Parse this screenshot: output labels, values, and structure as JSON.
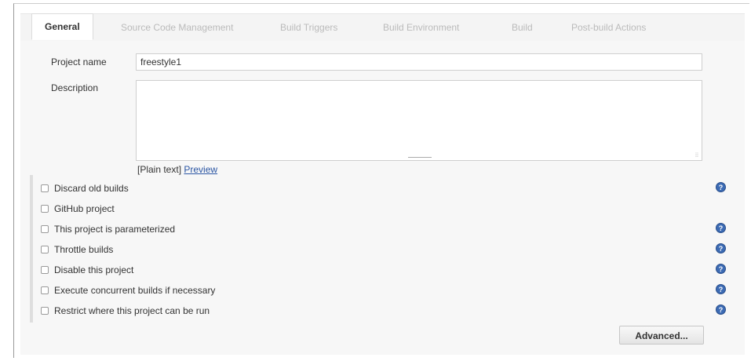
{
  "tabs": [
    {
      "label": "General",
      "active": true
    },
    {
      "label": "Source Code Management",
      "active": false
    },
    {
      "label": "Build Triggers",
      "active": false
    },
    {
      "label": "Build Environment",
      "active": false
    },
    {
      "label": "Build",
      "active": false
    },
    {
      "label": "Post-build Actions",
      "active": false
    }
  ],
  "form": {
    "project_name_label": "Project name",
    "project_name_value": "freestyle1",
    "description_label": "Description",
    "description_value": "",
    "plain_text": "[Plain text]",
    "preview_link": "Preview"
  },
  "options": [
    {
      "label": "Discard old builds",
      "checked": false,
      "help": true
    },
    {
      "label": "GitHub project",
      "checked": false,
      "help": false
    },
    {
      "label": "This project is parameterized",
      "checked": false,
      "help": true
    },
    {
      "label": "Throttle builds",
      "checked": false,
      "help": true
    },
    {
      "label": "Disable this project",
      "checked": false,
      "help": true
    },
    {
      "label": "Execute concurrent builds if necessary",
      "checked": false,
      "help": true
    },
    {
      "label": "Restrict where this project can be run",
      "checked": false,
      "help": true
    }
  ],
  "help_icon_glyph": "?",
  "advanced_button": "Advanced...",
  "colors": {
    "help_icon": "#3c6bb4",
    "link": "#2a55a3"
  }
}
